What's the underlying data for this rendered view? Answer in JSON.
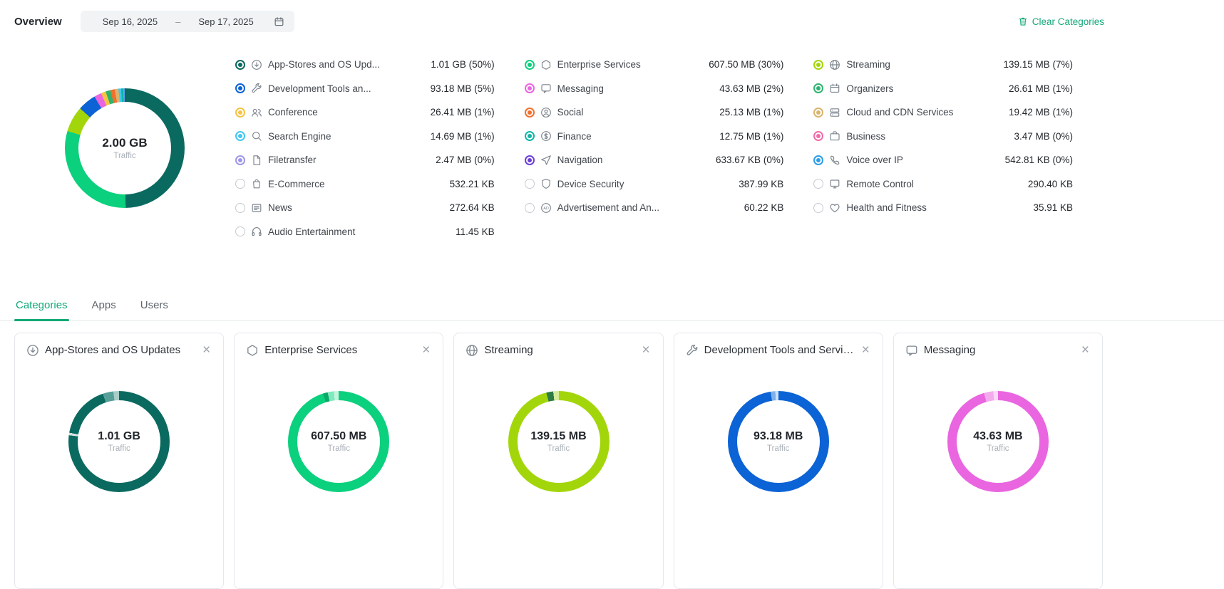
{
  "header": {
    "title": "Overview",
    "date_from": "Sep 16, 2025",
    "date_separator": "–",
    "date_to": "Sep 17, 2025",
    "clear_categories": "Clear Categories"
  },
  "tabs": [
    {
      "label": "Categories",
      "active": true
    },
    {
      "label": "Apps",
      "active": false
    },
    {
      "label": "Users",
      "active": false
    }
  ],
  "chart_data": {
    "type": "donut",
    "total": "2.00 GB",
    "subtitle": "Traffic",
    "segments": [
      {
        "name": "App-Stores and OS Updates",
        "color": "#0a6a60",
        "pct": 50
      },
      {
        "name": "Enterprise Services",
        "color": "#0bd07d",
        "pct": 30
      },
      {
        "name": "Streaming",
        "color": "#a3d60a",
        "pct": 7
      },
      {
        "name": "Development Tools and Services",
        "color": "#0b63d5",
        "pct": 5
      },
      {
        "name": "Messaging",
        "color": "#e966e0",
        "pct": 2
      },
      {
        "name": "Conference",
        "color": "#f6c344",
        "pct": 1.3
      },
      {
        "name": "Organizers",
        "color": "#2eb36e",
        "pct": 1.3
      },
      {
        "name": "Social",
        "color": "#f0702d",
        "pct": 1.2
      },
      {
        "name": "Cloud and CDN Services",
        "color": "#d9b46d",
        "pct": 1.0
      },
      {
        "name": "Search Engine",
        "color": "#43c7f0",
        "pct": 0.7
      },
      {
        "name": "Finance",
        "color": "#10b5a8",
        "pct": 0.6
      },
      {
        "name": "Business",
        "color": "#ef6daa",
        "pct": 0.2
      },
      {
        "name": "Filetransfer",
        "color": "#9e97e8",
        "pct": 0.12
      },
      {
        "name": "Voice over IP",
        "color": "#2f9ce8",
        "pct": 0.04
      },
      {
        "name": "Navigation",
        "color": "#6b3fd8",
        "pct": 0.04
      }
    ]
  },
  "legend": {
    "columns": [
      [
        {
          "label": "App-Stores and OS Upd...",
          "value": "1.01 GB (50%)",
          "color": "#0a6a60",
          "icon": "app-stores"
        },
        {
          "label": "Development Tools an...",
          "value": "93.18 MB (5%)",
          "color": "#0b63d5",
          "icon": "dev-tools"
        },
        {
          "label": "Conference",
          "value": "26.41 MB (1%)",
          "color": "#f6c344",
          "icon": "conference"
        },
        {
          "label": "Search Engine",
          "value": "14.69 MB (1%)",
          "color": "#43c7f0",
          "icon": "search"
        },
        {
          "label": "Filetransfer",
          "value": "2.47 MB (0%)",
          "color": "#9e97e8",
          "icon": "filetransfer"
        },
        {
          "label": "E-Commerce",
          "value": "532.21 KB",
          "color": null,
          "icon": "ecommerce"
        },
        {
          "label": "News",
          "value": "272.64 KB",
          "color": null,
          "icon": "news"
        },
        {
          "label": "Audio Entertainment",
          "value": "11.45 KB",
          "color": null,
          "icon": "audio"
        }
      ],
      [
        {
          "label": "Enterprise Services",
          "value": "607.50 MB (30%)",
          "color": "#0bd07d",
          "icon": "enterprise"
        },
        {
          "label": "Messaging",
          "value": "43.63 MB (2%)",
          "color": "#e966e0",
          "icon": "messaging"
        },
        {
          "label": "Social",
          "value": "25.13 MB (1%)",
          "color": "#f0702d",
          "icon": "social"
        },
        {
          "label": "Finance",
          "value": "12.75 MB (1%)",
          "color": "#10b5a8",
          "icon": "finance"
        },
        {
          "label": "Navigation",
          "value": "633.67 KB (0%)",
          "color": "#6b3fd8",
          "icon": "navigation"
        },
        {
          "label": "Device Security",
          "value": "387.99 KB",
          "color": null,
          "icon": "device-security"
        },
        {
          "label": "Advertisement and An...",
          "value": "60.22 KB",
          "color": null,
          "icon": "advertisement"
        }
      ],
      [
        {
          "label": "Streaming",
          "value": "139.15 MB (7%)",
          "color": "#a3d60a",
          "icon": "streaming"
        },
        {
          "label": "Organizers",
          "value": "26.61 MB (1%)",
          "color": "#2eb36e",
          "icon": "organizers"
        },
        {
          "label": "Cloud and CDN Services",
          "value": "19.42 MB (1%)",
          "color": "#d9b46d",
          "icon": "cloud-cdn"
        },
        {
          "label": "Business",
          "value": "3.47 MB (0%)",
          "color": "#ef6daa",
          "icon": "business"
        },
        {
          "label": "Voice over IP",
          "value": "542.81 KB (0%)",
          "color": "#2f9ce8",
          "icon": "voip"
        },
        {
          "label": "Remote Control",
          "value": "290.40 KB",
          "color": null,
          "icon": "remote-control"
        },
        {
          "label": "Health and Fitness",
          "value": "35.91 KB",
          "color": null,
          "icon": "health"
        }
      ]
    ]
  },
  "cards": [
    {
      "title": "App-Stores and OS Updates",
      "icon": "app-stores",
      "value": "1.01 GB",
      "subtitle": "Traffic",
      "segments": [
        {
          "color": "#0a6a60",
          "pct": 77
        },
        {
          "color": "#d2e2e0",
          "pct": 0.8
        },
        {
          "color": "#0a6a60",
          "pct": 17
        },
        {
          "color": "#57a099",
          "pct": 3.4
        },
        {
          "color": "#a8ccc8",
          "pct": 1.8
        }
      ]
    },
    {
      "title": "Enterprise Services",
      "icon": "enterprise",
      "value": "607.50 MB",
      "subtitle": "Traffic",
      "segments": [
        {
          "color": "#0bd07d",
          "pct": 95
        },
        {
          "color": "#0aa968",
          "pct": 1.5
        },
        {
          "color": "#7fe9bd",
          "pct": 2
        },
        {
          "color": "#c5f4de",
          "pct": 1.5
        }
      ]
    },
    {
      "title": "Streaming",
      "icon": "streaming",
      "value": "139.15 MB",
      "subtitle": "Traffic",
      "segments": [
        {
          "color": "#a3d60a",
          "pct": 96
        },
        {
          "color": "#2f7d46",
          "pct": 2.2
        },
        {
          "color": "#d6ec9a",
          "pct": 1.8
        }
      ]
    },
    {
      "title": "Development Tools and Services",
      "icon": "dev-tools",
      "value": "93.18 MB",
      "subtitle": "Traffic",
      "segments": [
        {
          "color": "#0b63d5",
          "pct": 97.5
        },
        {
          "color": "#7fb0ec",
          "pct": 1.5
        },
        {
          "color": "#cfe0f8",
          "pct": 1
        }
      ]
    },
    {
      "title": "Messaging",
      "icon": "messaging",
      "value": "43.63 MB",
      "subtitle": "Traffic",
      "segments": [
        {
          "color": "#e966e0",
          "pct": 95.5
        },
        {
          "color": "#f4abee",
          "pct": 3
        },
        {
          "color": "#fbd9f8",
          "pct": 1.5
        }
      ]
    }
  ]
}
